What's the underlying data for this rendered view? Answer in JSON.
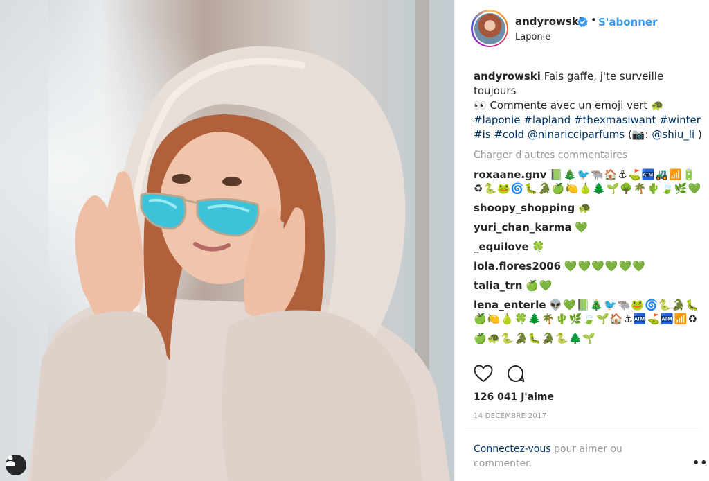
{
  "post": {
    "username": "andyrowski",
    "follow_label": "S'abonner",
    "location": "Laponie",
    "separator": "•"
  },
  "caption": {
    "author": "andyrowski",
    "text_1": "Fais gaffe, j'te surveille toujours",
    "text_2": "👀 Commente avec un emoji vert 🐢",
    "hashtags_1": "#laponie #lapland #thexmasiwant #winter",
    "hashtags_2": "#is #cold @ninaricciparfums",
    "camera": "(📷: ",
    "credit": "@shiu_li",
    "credit_close": " )"
  },
  "load_more": "Charger d'autres commentaires",
  "comments": [
    {
      "user": "roxaane.gnv",
      "text": "📗🎄🐦🐃🏠⚓⛳🏧🚜📶🔋♻🐍🐸🌀🐛🐊🍏🍋🍐🌲🌱🌳🌴🌵🍃🌿💚"
    },
    {
      "user": "shoopy_shopping",
      "text": "🐢"
    },
    {
      "user": "yuri_chan_karma",
      "text": "💚"
    },
    {
      "user": "_equilove",
      "text": "🍀"
    },
    {
      "user": "lola.flores2006",
      "text": "💚💚💚💚💚💚"
    },
    {
      "user": "talia_trn",
      "text": "🍏💚"
    },
    {
      "user": "lena_enterle",
      "text": "👽💚📗🎄🐦🐃🐸🌀🐍🐊🐛🍏🍋🍐🍀🌲🌴🌵🌿🍃🌱🏠⚓🏧⛳🏧📶♻"
    }
  ],
  "truncated_line": "🍏🐢🐍🐊🐛🐊🐍🌲🌱",
  "likes": "126 041 J'aime",
  "date": "14 DÉCEMBRE 2017",
  "login": {
    "link": "Connectez-vous",
    "text": " pour aimer ou commenter."
  },
  "more_options": "•••",
  "icons": {
    "verified": "verified-badge-icon",
    "like": "heart-icon",
    "comment": "speech-bubble-icon",
    "user_tag": "person-icon"
  },
  "colors": {
    "link": "#003569",
    "follow": "#3897f0",
    "muted": "#999999",
    "text": "#262626"
  }
}
